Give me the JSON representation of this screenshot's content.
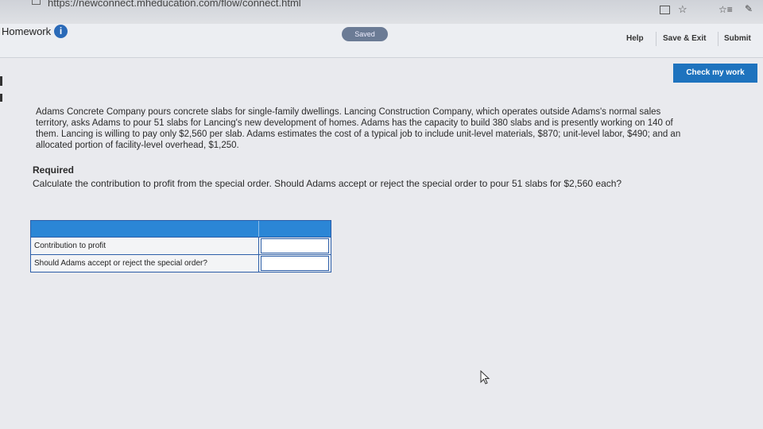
{
  "browser": {
    "url": "https://newconnect.mheducation.com/flow/connect.html",
    "icons": [
      "document-icon",
      "reader-view-icon",
      "favorite-star-icon",
      "favorites-icon",
      "pen-icon"
    ]
  },
  "header": {
    "title": "Homework",
    "info_symbol": "i",
    "status": "Saved",
    "help": "Help",
    "save_exit": "Save & Exit",
    "submit": "Submit"
  },
  "toolbar": {
    "check_work": "Check my work"
  },
  "problem": {
    "text": "Adams Concrete Company pours concrete slabs for single-family dwellings. Lancing Construction Company, which operates outside Adams's normal sales territory, asks Adams to pour 51 slabs for Lancing's new development of homes. Adams has the capacity to build 380 slabs and is presently working on 140 of them. Lancing is willing to pay only $2,560 per slab. Adams estimates the cost of a typical job to include unit-level materials, $870; unit-level labor, $490; and an allocated portion of facility-level overhead, $1,250.",
    "required_title": "Required",
    "required_text": "Calculate the contribution to profit from the special order. Should Adams accept or reject the special order to pour 51 slabs for $2,560 each?"
  },
  "answer_table": {
    "rows": [
      {
        "label": "Contribution to profit",
        "value": ""
      },
      {
        "label": "Should Adams accept or reject the special order?",
        "value": ""
      }
    ]
  },
  "colors": {
    "accent": "#1e73be",
    "table_header": "#2b86d6",
    "saved_badge": "#6b7b95"
  }
}
